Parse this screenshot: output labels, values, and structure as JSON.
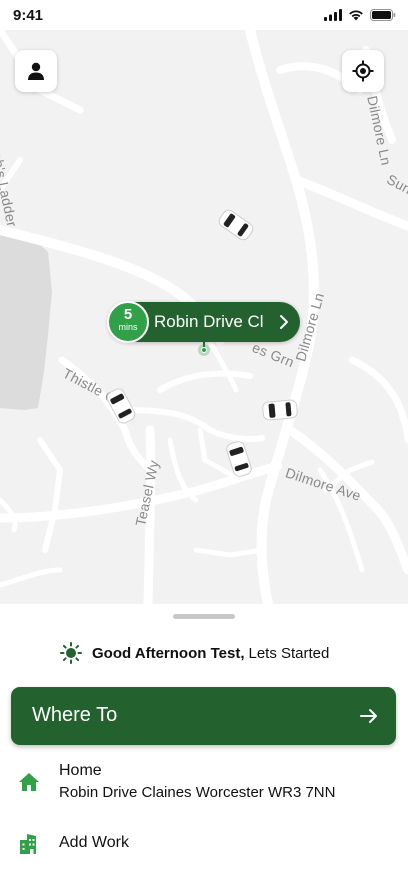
{
  "status_bar": {
    "time": "9:41"
  },
  "map": {
    "road_labels": [
      "Robin Drive Cl",
      "Dilmore Ln",
      "Dilmore Ln",
      "Dilmore Ave",
      "Thistle Cl",
      "Teasel Wy",
      "Jacob's Ladder",
      "Claines Grn",
      "Sun"
    ],
    "pickup": {
      "eta_value": "5",
      "eta_unit": "mins",
      "name": "Robin Drive Cl"
    }
  },
  "sheet": {
    "greeting_bold": "Good Afternoon Test,",
    "greeting_rest": "Lets Started",
    "where_to_label": "Where To",
    "saved_places": [
      {
        "title": "Home",
        "subtitle": "Robin Drive Claines Worcester WR3 7NN",
        "icon": "home-icon"
      },
      {
        "title": "Add Work",
        "icon": "work-building-icon"
      }
    ]
  },
  "colors": {
    "brand_green": "#23622f",
    "accent_green": "#31a048"
  }
}
